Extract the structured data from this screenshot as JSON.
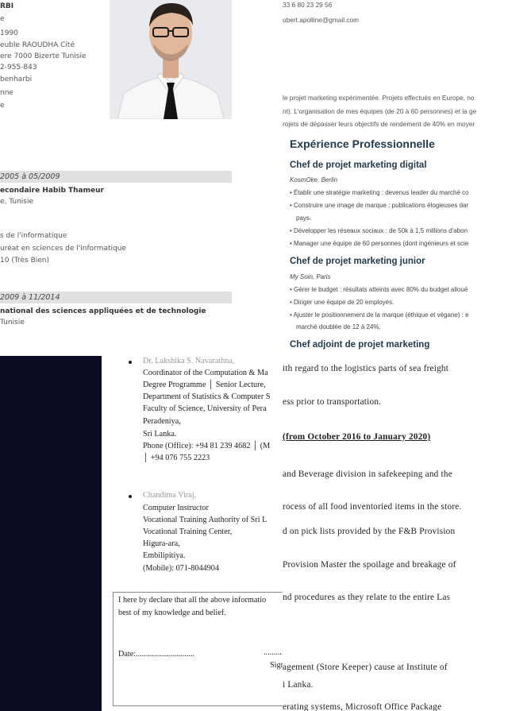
{
  "top_left_cv": {
    "contact_lines": [
      "RBI",
      "e",
      "1990",
      "euble RAOUDHA Cité",
      "ere 7000 Bizerte Tunisie",
      "2-955-843",
      "benharbi",
      "nne",
      "e"
    ],
    "education": [
      {
        "period": "2005 à 05/2009",
        "school": "econdaire Habib Thameur",
        "location": "e, Tunisie",
        "field": "s de l'informatique",
        "degree": "uréat en sciences de l'informatique",
        "grade": "10 (Très Bien)"
      },
      {
        "period": "2009 à 11/2014",
        "school": "national des sciences appliquées et de technologie",
        "location": "Tunisie"
      }
    ]
  },
  "top_right_cv": {
    "phone": "33 6 80 23 29 56",
    "email": "ubert.apolline@gmail.com",
    "summary_lines": [
      "le projet marketing expérimentée. Projets effectués en Europe, no",
      "nt). L'organisation de mes équipes (de 20 à 60 personnes) et la ge",
      "rojets de dépasser leurs objectifs de rendement de 40% en moyer"
    ],
    "section_title": "Expérience Professionnelle",
    "jobs": [
      {
        "title": "Chef de projet marketing digital",
        "company": "KosmOke, Berlin",
        "bullets": [
          "Établir une stratégie marketing : devenus leader du marché co",
          "Construire une image de marque : publications élogieuses dar",
          "pays.",
          "Développer les réseaux sociaux : de 50k à 1,5 millions d'abon",
          "Manager une équipe de 60 personnes (dont ingénieurs et scie"
        ]
      },
      {
        "title": "Chef de projet marketing junior",
        "company": "My Soin, Paris",
        "bullets": [
          "Gérer le budget : résultats atteints avec 80% du budget alloué",
          "Diriger une équipe de 20 employés.",
          "Ajuster le positionnement de la marque (éthique et végane) : e",
          "marché doublée de 12 à 24%."
        ]
      },
      {
        "title": "Chef adjoint de projet marketing"
      }
    ]
  },
  "bottom_left_cv": {
    "referees": [
      {
        "name": "Dr. Lakshika S. Navarathna,",
        "lines": [
          "Coordinator of the Computation & Ma",
          "Degree Programme │ Senior Lecture,",
          "Department of Statistics & Computer S",
          "Faculty of Science, University of Pera",
          "Peradeniya,",
          "Sri Lanka.",
          "Phone (Office): +94 81 239 4682 │ (M",
          "│ +94 076 755 2223"
        ]
      },
      {
        "name": "Chandima Viraj,",
        "lines": [
          "Computer Instructor",
          "Vocational Training Authority of Sri L",
          "Vocational Training Center,",
          "Higura-ara,",
          "Embilipitiya.",
          "(Mobile): 071-8044904"
        ]
      }
    ],
    "declaration_lines": [
      "I here by declare that all the above informatio",
      "best of my knowledge and belief."
    ],
    "date_label": "Date:.............................",
    "dots_right": "..........",
    "signature_label": "Sign"
  },
  "bottom_right_cv": {
    "lines": [
      "ith regard to the logistics parts of sea freight",
      "ess prior to transportation.",
      "(from October 2016 to January 2020)",
      "and Beverage division in safekeeping and the",
      "rocess of all food inventoried items in the store.",
      "d on pick lists provided by the F&B Provision",
      " Provision Master the spoilage and breakage of",
      "nd procedures as they relate to the entire Las",
      "agement (Store Keeper) cause  at Institute of",
      "i Lanka.",
      "erating systems, Microsoft Office Package"
    ]
  },
  "colors": {
    "heading": "#1f3a4d",
    "band": "#e0e0e0",
    "dark_panel": "#0b0b22"
  }
}
